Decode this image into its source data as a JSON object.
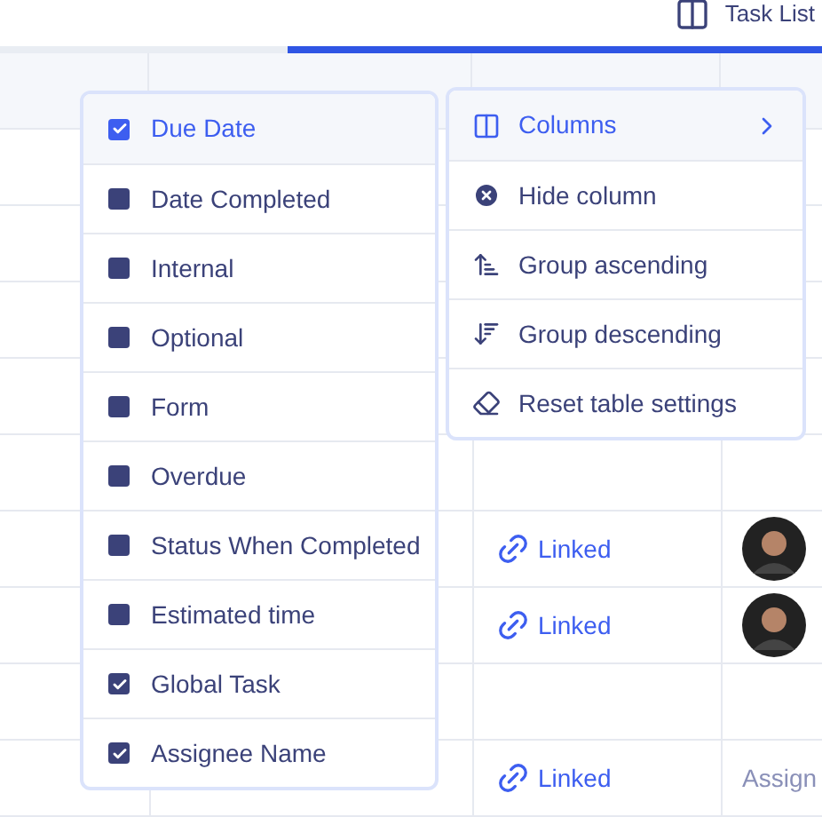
{
  "toolbar": {
    "view_button": "Task List"
  },
  "tabs": [
    {
      "selected": false
    },
    {
      "selected": true
    }
  ],
  "table": {
    "rows": [
      {
        "kind": "empty"
      },
      {
        "kind": "empty"
      },
      {
        "kind": "empty"
      },
      {
        "kind": "empty"
      },
      {
        "kind": "empty"
      },
      {
        "kind": "avatar",
        "global_task": "Linked"
      },
      {
        "kind": "avatar",
        "global_task": "Linked"
      },
      {
        "kind": "empty"
      },
      {
        "kind": "assign",
        "global_task": "Linked",
        "assignee": "Assign"
      }
    ]
  },
  "column_menu": {
    "items": [
      {
        "label": "Due Date",
        "checked": true,
        "selected": true
      },
      {
        "label": "Date Completed",
        "checked": false,
        "selected": false
      },
      {
        "label": "Internal",
        "checked": false,
        "selected": false
      },
      {
        "label": "Optional",
        "checked": false,
        "selected": false
      },
      {
        "label": "Form",
        "checked": false,
        "selected": false
      },
      {
        "label": "Overdue",
        "checked": false,
        "selected": false
      },
      {
        "label": "Status When Completed",
        "checked": false,
        "selected": false
      },
      {
        "label": "Estimated time",
        "checked": false,
        "selected": false
      },
      {
        "label": "Global Task",
        "checked": true,
        "selected": false
      },
      {
        "label": "Assignee Name",
        "checked": true,
        "selected": false
      }
    ]
  },
  "context_menu": {
    "items": [
      {
        "label": "Columns",
        "kind": "columns",
        "selected": true
      },
      {
        "label": "Hide column",
        "kind": "hide",
        "selected": false
      },
      {
        "label": "Group ascending",
        "kind": "asc",
        "selected": false
      },
      {
        "label": "Group descending",
        "kind": "desc",
        "selected": false
      },
      {
        "label": "Reset table settings",
        "kind": "reset",
        "selected": false
      }
    ]
  }
}
